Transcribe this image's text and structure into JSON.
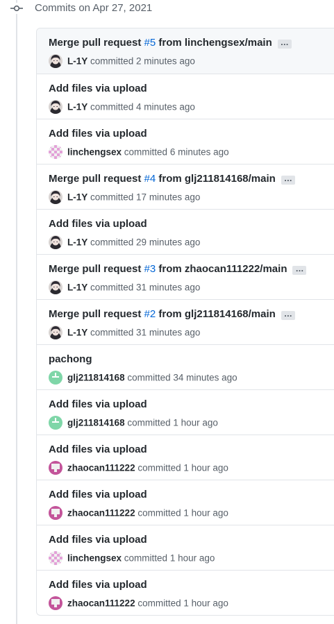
{
  "group": {
    "date_label": "Commits on Apr 27, 2021"
  },
  "commits": [
    {
      "title_prefix": "Merge pull request ",
      "pr_number": "#5",
      "title_suffix": " from linchengsex/main",
      "has_ellipsis": true,
      "ellipsis": "…",
      "author": "L-1Y",
      "time": "committed 2 minutes ago",
      "avatar_icon": "anime-avatar-icon"
    },
    {
      "title_prefix": "Add files via upload",
      "pr_number": "",
      "title_suffix": "",
      "has_ellipsis": false,
      "ellipsis": "",
      "author": "L-1Y",
      "time": "committed 4 minutes ago",
      "avatar_icon": "anime-avatar-icon"
    },
    {
      "title_prefix": "Add files via upload",
      "pr_number": "",
      "title_suffix": "",
      "has_ellipsis": false,
      "ellipsis": "",
      "author": "linchengsex",
      "time": "committed 6 minutes ago",
      "avatar_icon": "pink-identicon-icon"
    },
    {
      "title_prefix": "Merge pull request ",
      "pr_number": "#4",
      "title_suffix": " from glj211814168/main",
      "has_ellipsis": true,
      "ellipsis": "…",
      "author": "L-1Y",
      "time": "committed 17 minutes ago",
      "avatar_icon": "anime-avatar-icon"
    },
    {
      "title_prefix": "Add files via upload",
      "pr_number": "",
      "title_suffix": "",
      "has_ellipsis": false,
      "ellipsis": "",
      "author": "L-1Y",
      "time": "committed 29 minutes ago",
      "avatar_icon": "anime-avatar-icon"
    },
    {
      "title_prefix": "Merge pull request ",
      "pr_number": "#3",
      "title_suffix": " from zhaocan111222/main",
      "has_ellipsis": true,
      "ellipsis": "…",
      "author": "L-1Y",
      "time": "committed 31 minutes ago",
      "avatar_icon": "anime-avatar-icon"
    },
    {
      "title_prefix": "Merge pull request ",
      "pr_number": "#2",
      "title_suffix": " from glj211814168/main",
      "has_ellipsis": true,
      "ellipsis": "…",
      "author": "L-1Y",
      "time": "committed 31 minutes ago",
      "avatar_icon": "anime-avatar-icon"
    },
    {
      "title_prefix": "pachong",
      "pr_number": "",
      "title_suffix": "",
      "has_ellipsis": false,
      "ellipsis": "",
      "author": "glj211814168",
      "time": "committed 34 minutes ago",
      "avatar_icon": "green-identicon-icon"
    },
    {
      "title_prefix": "Add files via upload",
      "pr_number": "",
      "title_suffix": "",
      "has_ellipsis": false,
      "ellipsis": "",
      "author": "glj211814168",
      "time": "committed 1 hour ago",
      "avatar_icon": "green-identicon-icon"
    },
    {
      "title_prefix": "Add files via upload",
      "pr_number": "",
      "title_suffix": "",
      "has_ellipsis": false,
      "ellipsis": "",
      "author": "zhaocan111222",
      "time": "committed 1 hour ago",
      "avatar_icon": "magenta-identicon-icon"
    },
    {
      "title_prefix": "Add files via upload",
      "pr_number": "",
      "title_suffix": "",
      "has_ellipsis": false,
      "ellipsis": "",
      "author": "zhaocan111222",
      "time": "committed 1 hour ago",
      "avatar_icon": "magenta-identicon-icon"
    },
    {
      "title_prefix": "Add files via upload",
      "pr_number": "",
      "title_suffix": "",
      "has_ellipsis": false,
      "ellipsis": "",
      "author": "linchengsex",
      "time": "committed 1 hour ago",
      "avatar_icon": "pink-identicon-icon"
    },
    {
      "title_prefix": "Add files via upload",
      "pr_number": "",
      "title_suffix": "",
      "has_ellipsis": false,
      "ellipsis": "",
      "author": "zhaocan111222",
      "time": "committed 1 hour ago",
      "avatar_icon": "magenta-identicon-icon"
    }
  ],
  "colors": {
    "link": "#0366d6",
    "muted_text": "#586069",
    "border": "#e1e4e8",
    "identicon_green": "#7fd6a8",
    "identicon_pink": "#e3a1d8",
    "identicon_magenta": "#c3549a"
  }
}
